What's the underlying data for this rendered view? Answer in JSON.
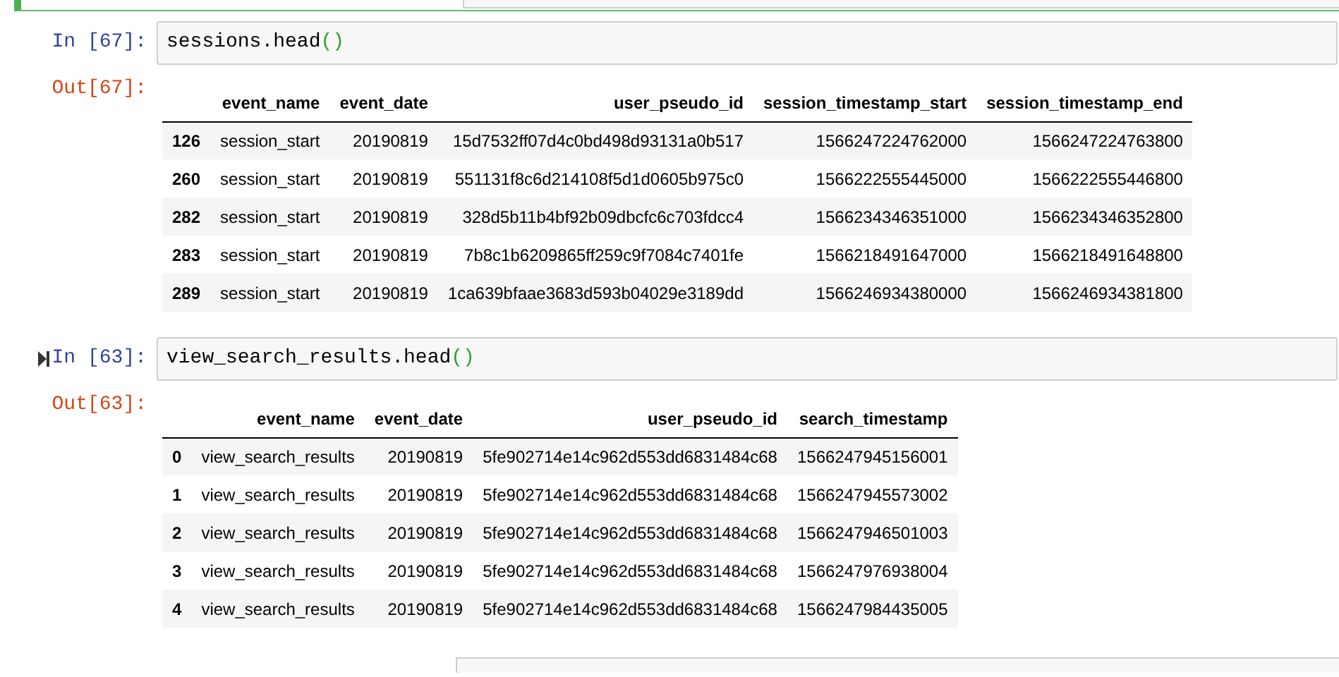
{
  "cells": [
    {
      "selected": true
    },
    {
      "selected": false,
      "running": false,
      "prompt": "In [67]:",
      "code": [
        {
          "kind": "name",
          "text": "sessions.head"
        },
        {
          "kind": "paren",
          "text": "()"
        }
      ],
      "output": {
        "prompt": "Out[67]:",
        "columns": [
          "",
          "event_name",
          "event_date",
          "user_pseudo_id",
          "session_timestamp_start",
          "session_timestamp_end"
        ],
        "rows": [
          [
            "126",
            "session_start",
            "20190819",
            "15d7532ff07d4c0bd498d93131a0b517",
            "1566247224762000",
            "1566247224763800"
          ],
          [
            "260",
            "session_start",
            "20190819",
            "551131f8c6d214108f5d1d0605b975c0",
            "1566222555445000",
            "1566222555446800"
          ],
          [
            "282",
            "session_start",
            "20190819",
            "328d5b11b4bf92b09dbcfc6c703fdcc4",
            "1566234346351000",
            "1566234346352800"
          ],
          [
            "283",
            "session_start",
            "20190819",
            "7b8c1b6209865ff259c9f7084c7401fe",
            "1566218491647000",
            "1566218491648800"
          ],
          [
            "289",
            "session_start",
            "20190819",
            "1ca639bfaae3683d593b04029e3189dd",
            "1566246934380000",
            "1566246934381800"
          ]
        ]
      }
    },
    {
      "selected": false,
      "running": true,
      "prompt": "In [63]:",
      "code": [
        {
          "kind": "name",
          "text": "view_search_results.head"
        },
        {
          "kind": "paren",
          "text": "()"
        }
      ],
      "output": {
        "prompt": "Out[63]:",
        "columns": [
          "",
          "event_name",
          "event_date",
          "user_pseudo_id",
          "search_timestamp"
        ],
        "rows": [
          [
            "0",
            "view_search_results",
            "20190819",
            "5fe902714e14c962d553dd6831484c68",
            "1566247945156001"
          ],
          [
            "1",
            "view_search_results",
            "20190819",
            "5fe902714e14c962d553dd6831484c68",
            "1566247945573002"
          ],
          [
            "2",
            "view_search_results",
            "20190819",
            "5fe902714e14c962d553dd6831484c68",
            "1566247946501003"
          ],
          [
            "3",
            "view_search_results",
            "20190819",
            "5fe902714e14c962d553dd6831484c68",
            "1566247976938004"
          ],
          [
            "4",
            "view_search_results",
            "20190819",
            "5fe902714e14c962d553dd6831484c68",
            "1566247984435005"
          ]
        ]
      }
    },
    {
      "selected": false
    }
  ]
}
